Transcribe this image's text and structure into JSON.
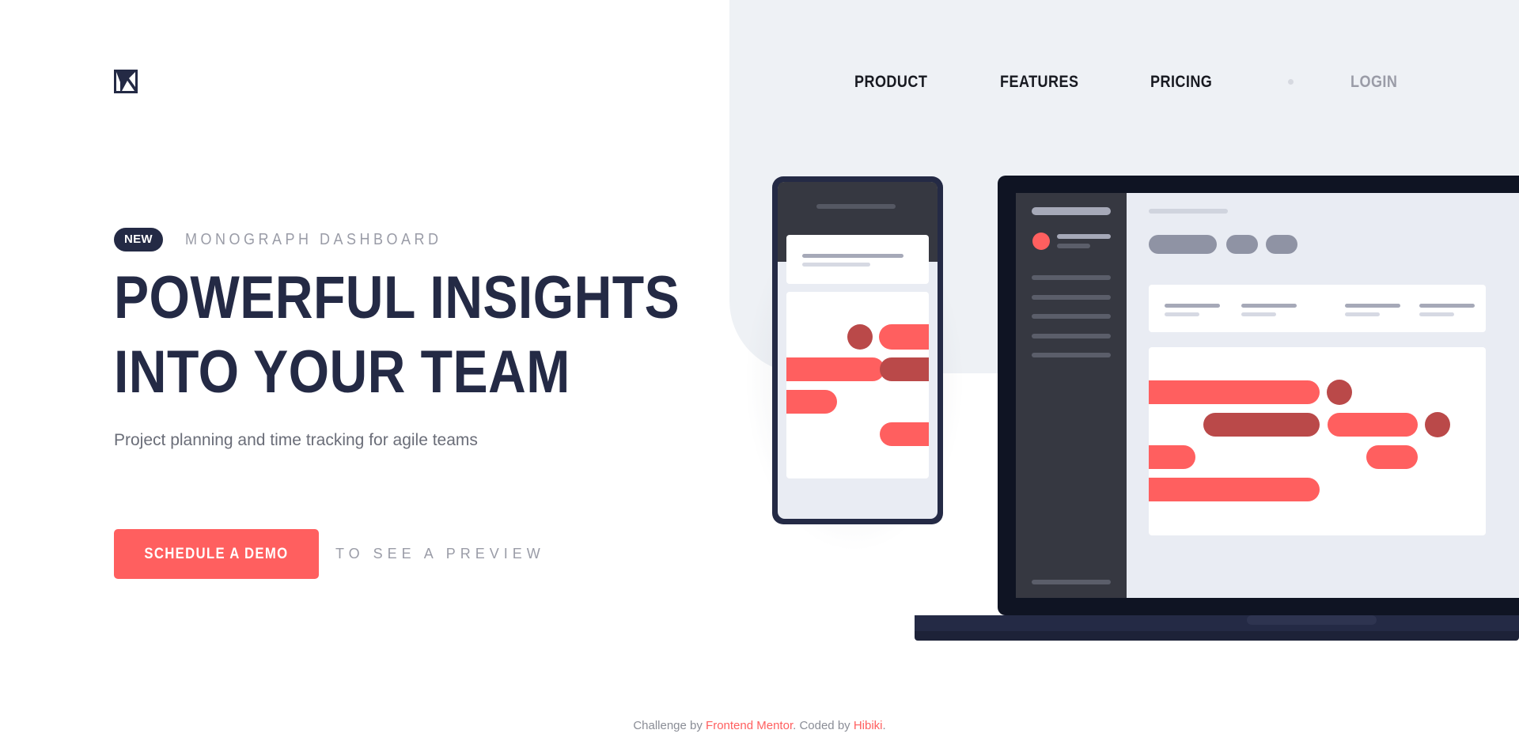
{
  "nav": {
    "product": "PRODUCT",
    "features": "FEATURES",
    "pricing": "PRICING",
    "login": "LOGIN"
  },
  "hero": {
    "badge": "NEW",
    "eyebrow": "MONOGRAPH DASHBOARD",
    "headline_line1": "POWERFUL INSIGHTS",
    "headline_line2": "INTO YOUR TEAM",
    "subtext": "Project planning and time tracking for agile teams",
    "cta_label": "SCHEDULE A DEMO",
    "cta_note": "TO SEE A PREVIEW"
  },
  "footer": {
    "prefix": "Challenge by ",
    "link1": "Frontend Mentor",
    "middle": ". Coded by ",
    "link2": "Hibiki",
    "suffix": "."
  },
  "colors": {
    "accent": "#ff5f5f",
    "accent_dark": "#ba4949",
    "navy": "#242a45",
    "panel": "#eef1f5",
    "muted": "#9a9ca7"
  },
  "icons": {
    "logo": "monograph-logo-icon"
  }
}
